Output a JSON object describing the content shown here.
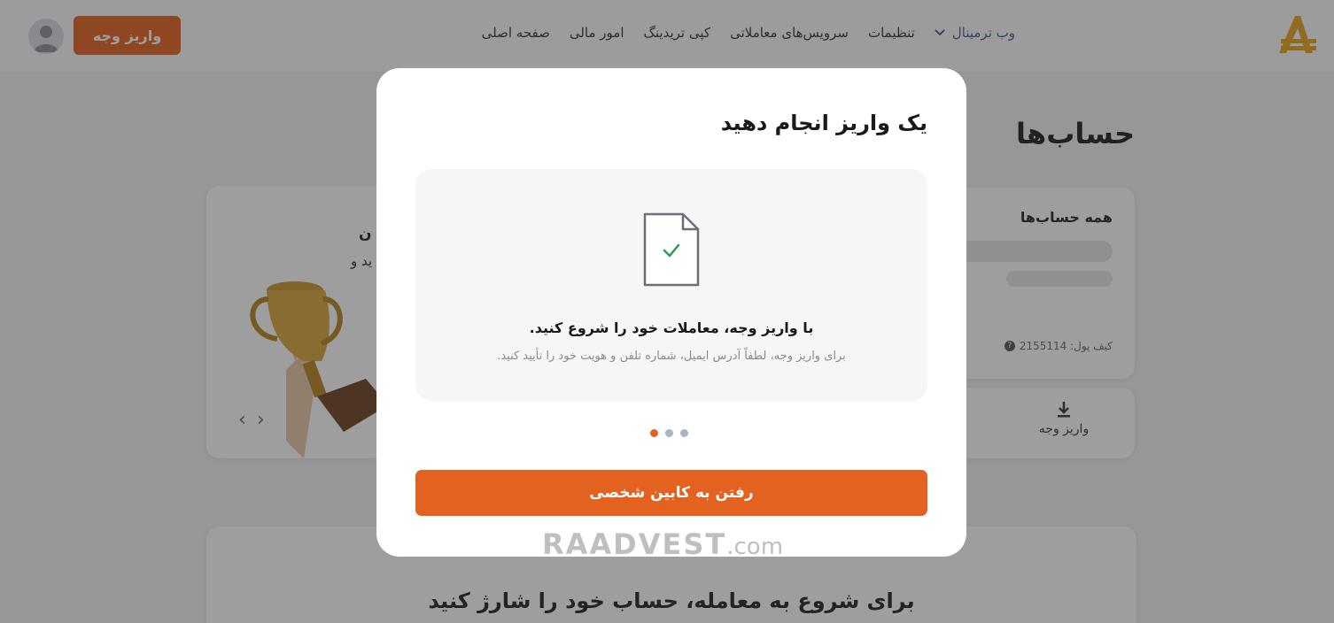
{
  "header": {
    "nav": [
      {
        "label": "صفحه اصلی"
      },
      {
        "label": "امور مالی"
      },
      {
        "label": "کپی تریدینگ"
      },
      {
        "label": "سرویس‌های معاملاتی"
      },
      {
        "label": "تنظیمات"
      },
      {
        "label": "وب ترمینال"
      }
    ],
    "deposit_button": "واریز وجه"
  },
  "page": {
    "title": "حساب‌ها",
    "accounts_card_title": "همه حساب‌ها",
    "wallet_label": "کیف پول: 2155114",
    "deposit_action": "واریز وجه",
    "promo_line1": "ن",
    "promo_line2": "ید و",
    "bottom_text": "برای شروع به معامله، حساب خود را شارژ کنید"
  },
  "modal": {
    "title": "یک واریز انجام دهید",
    "slide_title": "با واریز وجه، معاملات خود را شروع کنید.",
    "slide_subtitle": "برای واریز وجه، لطفاً آدرس ایمیل، شماره تلفن و هویت خود را تأیید کنید.",
    "slides_total": 3,
    "active_slide": 1,
    "cta": "رفتن به کابین شخصی"
  },
  "watermark": {
    "main": "RAADVEST",
    "suffix": ".com"
  },
  "colors": {
    "accent": "#e4621f",
    "dot_inactive": "#a9b3c2",
    "link": "#3d5a99"
  }
}
